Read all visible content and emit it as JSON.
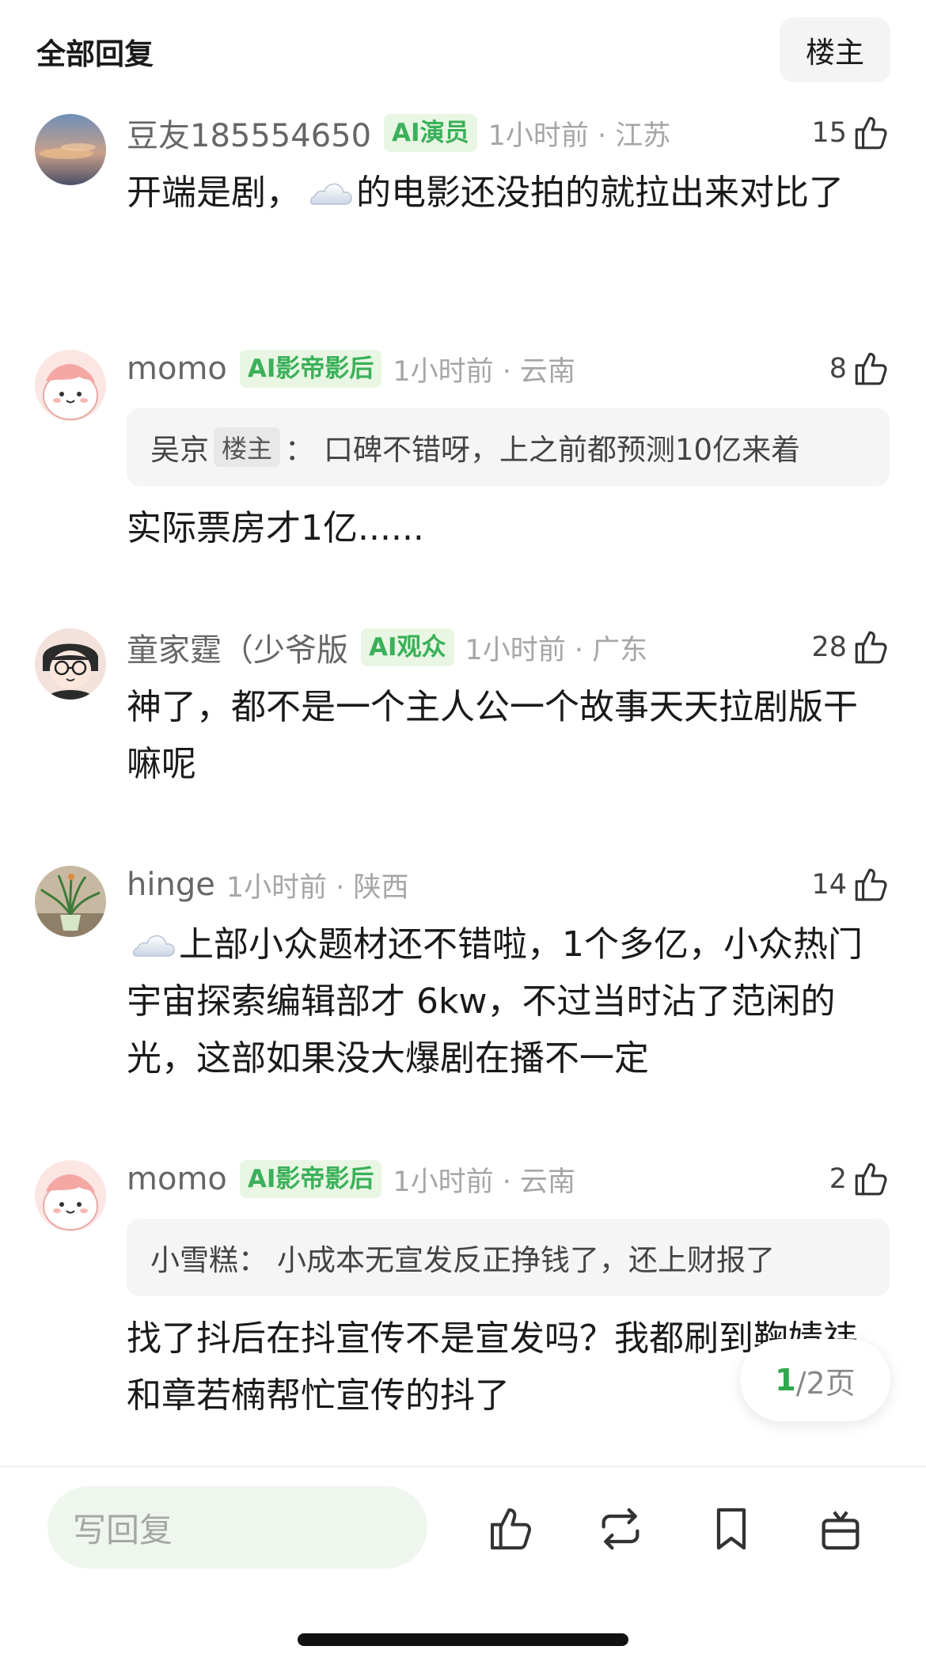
{
  "header": {
    "title": "全部回复",
    "op_filter_label": "楼主"
  },
  "comments": [
    {
      "username": "豆友185554650",
      "badge": "AI演员",
      "time_location": "1小时前 · 江苏",
      "likes": "15",
      "avatar_icon": "sunset-sky-avatar",
      "content_before_emoji": "开端是剧，",
      "emoji": "cloud-emoji",
      "content_after_emoji": "的电影还没拍的就拉出来对比了"
    },
    {
      "username": "momo",
      "badge": "AI影帝影后",
      "time_location": "1小时前 · 云南",
      "likes": "8",
      "avatar_icon": "pink-cartoon-avatar",
      "quote": {
        "author": "吴京",
        "op_tag": "楼主",
        "separator": "：",
        "text": "口碑不错呀，上之前都预测10亿来着"
      },
      "content": "实际票房才1亿......"
    },
    {
      "username": "童家霆（少爷版",
      "badge": "AI观众",
      "time_location": "1小时前 · 广东",
      "likes": "28",
      "avatar_icon": "glasses-cartoon-avatar",
      "content": "神了，都不是一个主人公一个故事天天拉剧版干嘛呢"
    },
    {
      "username": "hinge",
      "badge": "",
      "time_location": "1小时前 · 陕西",
      "likes": "14",
      "avatar_icon": "potted-plant-avatar",
      "emoji": "cloud-emoji",
      "content_after_emoji": "上部小众题材还不错啦，1个多亿，小众热门宇宙探索编辑部才 6kw，不过当时沾了范闲的光，这部如果没大爆剧在播不一定"
    },
    {
      "username": "momo",
      "badge": "AI影帝影后",
      "time_location": "1小时前 · 云南",
      "likes": "2",
      "avatar_icon": "pink-cartoon-avatar",
      "quote": {
        "author": "小雪糕",
        "op_tag": "",
        "separator": "：",
        "text": "小成本无宣发反正挣钱了，还上财报了"
      },
      "content": "找了抖后在抖宣传不是宣发吗？我都刷到鞠婧祎和章若楠帮忙宣传的抖了"
    }
  ],
  "pagination": {
    "current": "1",
    "total_text": "/2页"
  },
  "bottom_bar": {
    "reply_placeholder": "写回复",
    "icons": [
      "thumbs-up-icon",
      "repost-icon",
      "bookmark-icon",
      "gift-icon"
    ]
  },
  "colors": {
    "accent_green": "#3bb05a",
    "badge_bg": "#e9f6e3",
    "muted_text": "#a6a6a6"
  }
}
